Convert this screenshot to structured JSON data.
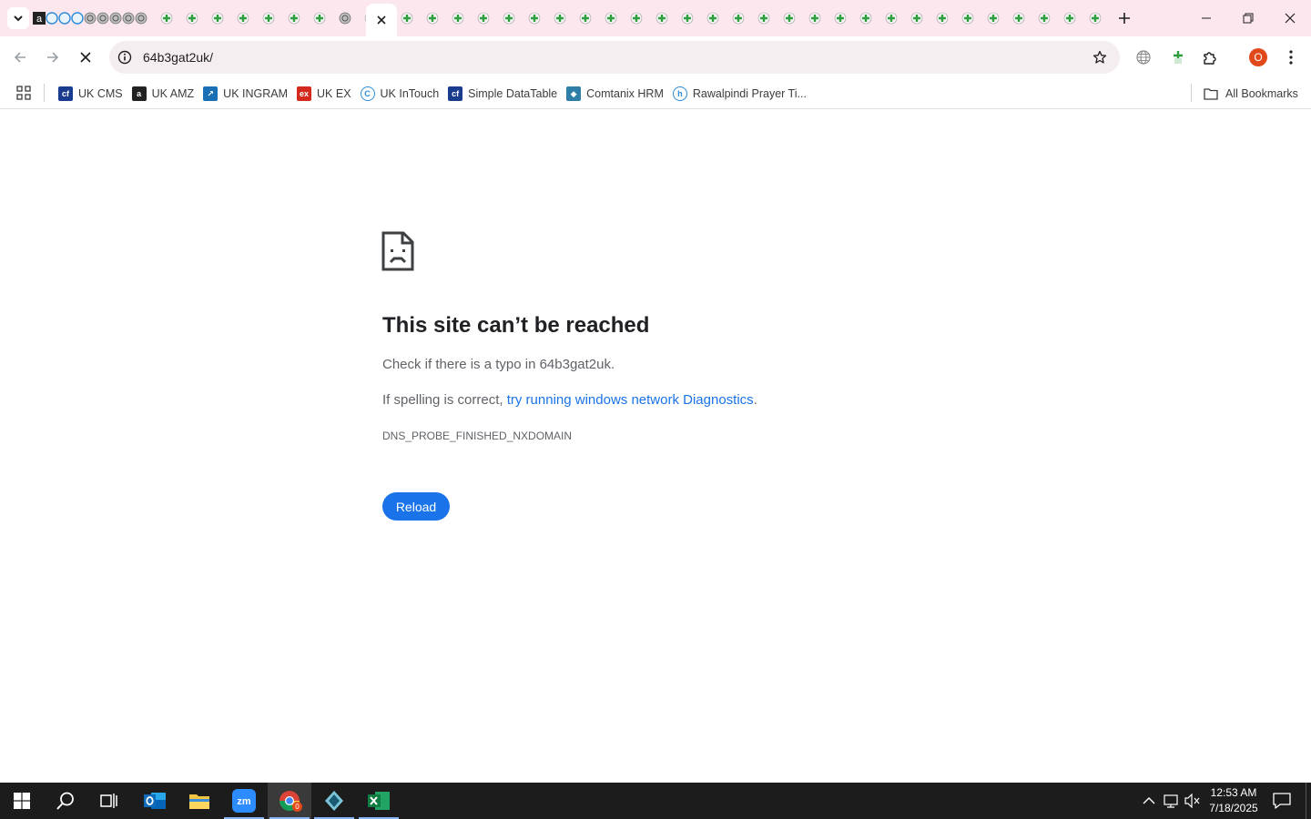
{
  "browser": {
    "active_tab_close": "×",
    "url": "64b3gat2uk/",
    "profile_initial": "O"
  },
  "bookmarks": {
    "items": [
      {
        "label": "UK CMS",
        "icon": "cms-favicon",
        "color": "#1a3c8f",
        "glyph": "cf"
      },
      {
        "label": "UK AMZ",
        "icon": "amazon-favicon",
        "color": "#222222",
        "glyph": "a"
      },
      {
        "label": "UK INGRAM",
        "icon": "ingram-favicon",
        "color": "#1b6fb5",
        "glyph": "↗"
      },
      {
        "label": "UK EX",
        "icon": "ex-favicon",
        "color": "#d42a1e",
        "glyph": "ex"
      },
      {
        "label": "UK InTouch",
        "icon": "intouch-favicon",
        "color": "#ffffff",
        "glyph": "C"
      },
      {
        "label": "Simple DataTable",
        "icon": "datatable-favicon",
        "color": "#1a3c8f",
        "glyph": "cf"
      },
      {
        "label": "Comtanix HRM",
        "icon": "comtanix-favicon",
        "color": "#2f7ea8",
        "glyph": "◆"
      },
      {
        "label": "Rawalpindi Prayer Ti...",
        "icon": "prayer-favicon",
        "color": "#ffffff",
        "glyph": "h"
      }
    ],
    "all_label": "All Bookmarks"
  },
  "error": {
    "title": "This site can’t be reached",
    "line1": "Check if there is a typo in 64b3gat2uk.",
    "line2_prefix": "If spelling is correct, ",
    "line2_link": "try running windows network Diagnostics",
    "line2_suffix": ".",
    "code": "DNS_PROBE_FINISHED_NXDOMAIN",
    "reload_label": "Reload"
  },
  "taskbar": {
    "time": "12:53 AM",
    "date": "7/18/2025",
    "chrome_badge": "0"
  },
  "colors": {
    "tab_strip": "#fde7ef",
    "link": "#1a73e8",
    "reload_button": "#1a73e8",
    "taskbar": "#1c1c1c",
    "profile": "#e2491a"
  }
}
